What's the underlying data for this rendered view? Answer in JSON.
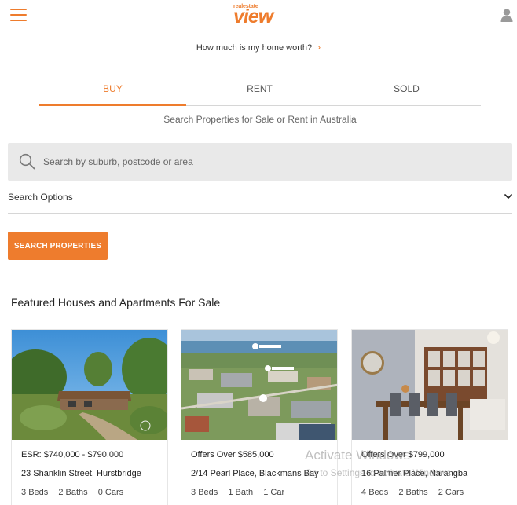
{
  "header": {
    "logo_small": "realestate",
    "logo_big": "view",
    "menu_icon": "hamburger-menu-icon",
    "account_icon": "user-icon"
  },
  "worth_link": {
    "label": "How much is my home worth?",
    "icon": "chevron-right-icon"
  },
  "tabs": [
    {
      "label": "BUY",
      "active": true
    },
    {
      "label": "RENT",
      "active": false
    },
    {
      "label": "SOLD",
      "active": false
    }
  ],
  "search": {
    "subtitle": "Search Properties for Sale or Rent in Australia",
    "placeholder": "Search by suburb, postcode or area",
    "value": "",
    "icon": "search-icon",
    "options_label": "Search Options",
    "options_icon": "chevron-down-icon",
    "button_label": "SEARCH PROPERTIES"
  },
  "featured": {
    "title": "Featured Houses and Apartments For Sale",
    "listings": [
      {
        "price": "ESR: $740,000 - $790,000",
        "address": "23 Shanklin Street, Hurstbridge",
        "beds": "3",
        "baths": "2",
        "cars": "0",
        "beds_label": "Beds",
        "baths_label": "Baths",
        "cars_label": "Cars"
      },
      {
        "price": "Offers Over $585,000",
        "address": "2/14 Pearl Place, Blackmans Bay",
        "beds": "3",
        "baths": "1",
        "cars": "1",
        "beds_label": "Beds",
        "baths_label": "Bath",
        "cars_label": "Car"
      },
      {
        "price": "Offers Over $799,000",
        "address": "16 Palmer Place, Narangba",
        "beds": "4",
        "baths": "2",
        "cars": "2",
        "beds_label": "Beds",
        "baths_label": "Baths",
        "cars_label": "Cars"
      }
    ]
  },
  "watermark": {
    "title": "Activate Windows",
    "subtitle": "Go to Settings to activate Windows."
  },
  "colors": {
    "accent": "#ee7c2d",
    "search_bg": "#e9e9e9",
    "divider": "#d6d6d6"
  }
}
